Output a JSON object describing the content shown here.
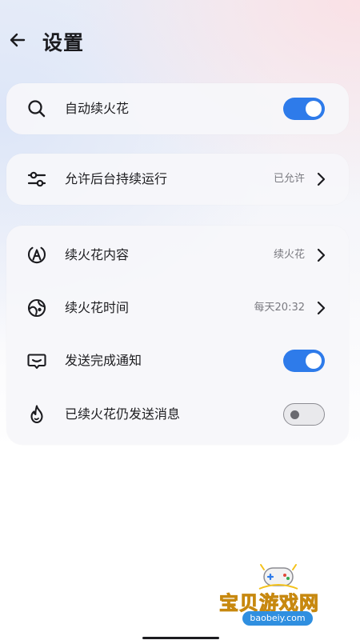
{
  "header": {
    "title": "设置",
    "back_icon": "arrow-left-icon"
  },
  "card1": {
    "row": {
      "icon": "search-icon",
      "label": "自动续火花",
      "toggle_on": true
    }
  },
  "card2": {
    "row": {
      "icon": "sliders-icon",
      "label": "允许后台持续运行",
      "value": "已允许",
      "chevron": "chevron-right-icon"
    }
  },
  "card3": {
    "rows": [
      {
        "icon": "letter-a-icon",
        "label": "续火花内容",
        "value": "续火花",
        "chevron": "chevron-right-icon"
      },
      {
        "icon": "clock-icon",
        "label": "续火花时间",
        "value": "每天20:32",
        "chevron": "chevron-right-icon"
      },
      {
        "icon": "message-icon",
        "label": "发送完成通知",
        "toggle_on": true
      },
      {
        "icon": "flame-icon",
        "label": "已续火花仍发送消息",
        "toggle_on": false
      }
    ]
  },
  "watermark": {
    "text": "宝贝游戏网",
    "url": "baobeiy.com",
    "icon": "gamepad-icon"
  },
  "colors": {
    "accent": "#2e7bea",
    "toggle_off": "#e9e9ec",
    "watermark_text": "#f4c21a",
    "watermark_badge": "#2f8fe0"
  }
}
